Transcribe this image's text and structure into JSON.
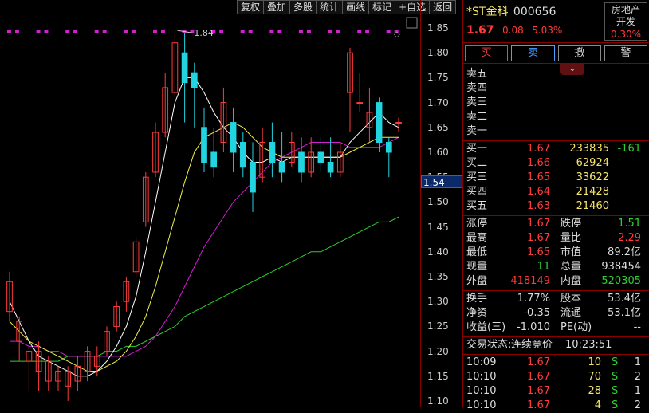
{
  "toolbar": [
    "复权",
    "叠加",
    "多股",
    "统计",
    "画线",
    "标记",
    "+自选",
    "返回"
  ],
  "chart": {
    "y_ticks": [
      "1.85",
      "1.80",
      "1.75",
      "1.70",
      "1.65",
      "1.60",
      "1.55",
      "1.50",
      "1.45",
      "1.40",
      "1.35",
      "1.30",
      "1.25",
      "1.20",
      "1.15",
      "1.10"
    ],
    "cursor_price": "1.54",
    "high_marker": "1.84"
  },
  "chart_data": {
    "type": "candlestick",
    "ylim": [
      1.1,
      1.85
    ],
    "candles": [
      [
        1.28,
        1.34,
        1.26,
        1.36
      ],
      [
        1.22,
        1.26,
        1.18,
        1.27
      ],
      [
        1.18,
        1.2,
        1.12,
        1.21
      ],
      [
        1.16,
        1.2,
        1.12,
        1.22
      ],
      [
        1.14,
        1.18,
        1.12,
        1.19
      ],
      [
        1.14,
        1.16,
        1.12,
        1.17
      ],
      [
        1.13,
        1.16,
        1.1,
        1.17
      ],
      [
        1.14,
        1.17,
        1.12,
        1.19
      ],
      [
        1.16,
        1.2,
        1.14,
        1.21
      ],
      [
        1.17,
        1.19,
        1.15,
        1.21
      ],
      [
        1.2,
        1.24,
        1.19,
        1.25
      ],
      [
        1.25,
        1.29,
        1.24,
        1.3
      ],
      [
        1.3,
        1.34,
        1.28,
        1.35
      ],
      [
        1.36,
        1.42,
        1.35,
        1.43
      ],
      [
        1.46,
        1.55,
        1.45,
        1.56
      ],
      [
        1.56,
        1.64,
        1.55,
        1.66
      ],
      [
        1.64,
        1.73,
        1.63,
        1.76
      ],
      [
        1.72,
        1.82,
        1.71,
        1.84
      ],
      [
        1.8,
        1.74,
        1.66,
        1.84
      ],
      [
        1.76,
        1.73,
        1.65,
        1.78
      ],
      [
        1.65,
        1.58,
        1.56,
        1.69
      ],
      [
        1.6,
        1.57,
        1.55,
        1.65
      ],
      [
        1.62,
        1.7,
        1.6,
        1.73
      ],
      [
        1.66,
        1.6,
        1.56,
        1.69
      ],
      [
        1.62,
        1.57,
        1.55,
        1.64
      ],
      [
        1.58,
        1.52,
        1.48,
        1.62
      ],
      [
        1.55,
        1.62,
        1.54,
        1.65
      ],
      [
        1.62,
        1.58,
        1.55,
        1.66
      ],
      [
        1.58,
        1.56,
        1.54,
        1.64
      ],
      [
        1.58,
        1.62,
        1.57,
        1.64
      ],
      [
        1.6,
        1.56,
        1.54,
        1.63
      ],
      [
        1.56,
        1.6,
        1.55,
        1.63
      ],
      [
        1.6,
        1.58,
        1.56,
        1.63
      ],
      [
        1.58,
        1.56,
        1.55,
        1.63
      ],
      [
        1.56,
        1.6,
        1.55,
        1.62
      ],
      [
        1.72,
        1.8,
        1.64,
        1.81
      ],
      [
        1.7,
        1.7,
        1.68,
        1.76
      ],
      [
        1.65,
        1.68,
        1.62,
        1.73
      ],
      [
        1.7,
        1.62,
        1.6,
        1.71
      ],
      [
        1.62,
        1.6,
        1.55,
        1.63
      ],
      [
        1.66,
        1.66,
        1.64,
        1.67
      ]
    ],
    "ma5": [
      1.3,
      1.26,
      1.22,
      1.19,
      1.18,
      1.17,
      1.16,
      1.15,
      1.15,
      1.16,
      1.18,
      1.21,
      1.25,
      1.31,
      1.4,
      1.5,
      1.6,
      1.7,
      1.75,
      1.75,
      1.72,
      1.68,
      1.65,
      1.63,
      1.6,
      1.58,
      1.58,
      1.59,
      1.58,
      1.59,
      1.59,
      1.59,
      1.59,
      1.59,
      1.59,
      1.62,
      1.64,
      1.66,
      1.68,
      1.66,
      1.65
    ],
    "ma10": [
      1.26,
      1.24,
      1.22,
      1.21,
      1.2,
      1.19,
      1.18,
      1.17,
      1.16,
      1.16,
      1.17,
      1.18,
      1.2,
      1.23,
      1.27,
      1.33,
      1.4,
      1.47,
      1.54,
      1.6,
      1.63,
      1.64,
      1.65,
      1.66,
      1.65,
      1.63,
      1.61,
      1.6,
      1.59,
      1.59,
      1.59,
      1.59,
      1.59,
      1.59,
      1.59,
      1.6,
      1.61,
      1.62,
      1.63,
      1.63,
      1.63
    ],
    "ma20": [
      1.22,
      1.22,
      1.21,
      1.21,
      1.2,
      1.2,
      1.19,
      1.19,
      1.19,
      1.19,
      1.19,
      1.19,
      1.19,
      1.2,
      1.21,
      1.23,
      1.26,
      1.29,
      1.33,
      1.37,
      1.41,
      1.44,
      1.47,
      1.5,
      1.52,
      1.54,
      1.56,
      1.58,
      1.59,
      1.6,
      1.61,
      1.62,
      1.62,
      1.62,
      1.62,
      1.61,
      1.61,
      1.61,
      1.61,
      1.62,
      1.63
    ],
    "ma60": [
      1.18,
      1.18,
      1.18,
      1.18,
      1.18,
      1.18,
      1.19,
      1.19,
      1.19,
      1.19,
      1.2,
      1.2,
      1.21,
      1.21,
      1.22,
      1.23,
      1.24,
      1.25,
      1.27,
      1.28,
      1.29,
      1.3,
      1.31,
      1.32,
      1.33,
      1.34,
      1.35,
      1.36,
      1.37,
      1.38,
      1.39,
      1.4,
      1.4,
      1.41,
      1.42,
      1.43,
      1.44,
      1.45,
      1.46,
      1.46,
      1.47
    ]
  },
  "stock": {
    "name": "*ST金科",
    "code": "000656",
    "price": "1.67",
    "change": "0.08",
    "pct": "5.03%",
    "sector": "房地产开发",
    "sector_pct": "0.30%"
  },
  "buttons": {
    "buy": "买",
    "sell": "卖",
    "cancel": "撤",
    "alert": "警"
  },
  "asks": [
    {
      "label": "卖五"
    },
    {
      "label": "卖四"
    },
    {
      "label": "卖三"
    },
    {
      "label": "卖二"
    },
    {
      "label": "卖一"
    }
  ],
  "bids": [
    {
      "label": "买一",
      "price": "1.67",
      "vol": "233835",
      "delta": "-161"
    },
    {
      "label": "买二",
      "price": "1.66",
      "vol": "62924",
      "delta": ""
    },
    {
      "label": "买三",
      "price": "1.65",
      "vol": "33622",
      "delta": ""
    },
    {
      "label": "买四",
      "price": "1.64",
      "vol": "21428",
      "delta": ""
    },
    {
      "label": "买五",
      "price": "1.63",
      "vol": "21460",
      "delta": ""
    }
  ],
  "stats": [
    {
      "l1": "涨停",
      "v1": "1.67",
      "l2": "跌停",
      "v2": "1.51"
    },
    {
      "l1": "最高",
      "v1": "1.67",
      "l2": "量比",
      "v2": "2.29"
    },
    {
      "l1": "最低",
      "v1": "1.65",
      "l2": "市值",
      "v2": "89.2亿"
    },
    {
      "l1": "现量",
      "v1": "11",
      "l2": "总量",
      "v2": "938454"
    },
    {
      "l1": "外盘",
      "v1": "418149",
      "l2": "内盘",
      "v2": "520305"
    }
  ],
  "stats2": [
    {
      "l1": "换手",
      "v1": "1.77%",
      "l2": "股本",
      "v2": "53.4亿"
    },
    {
      "l1": "净资",
      "v1": "-0.35",
      "l2": "流通",
      "v2": "53.1亿"
    },
    {
      "l1": "收益(三)",
      "v1": "-1.010",
      "l2": "PE(动)",
      "v2": "--"
    }
  ],
  "status": {
    "label": "交易状态:",
    "value": "连续竞价",
    "time": "10:23:51"
  },
  "ticks": [
    {
      "time": "10:09",
      "price": "1.67",
      "vol": "10",
      "side": "S",
      "n": "1"
    },
    {
      "time": "10:10",
      "price": "1.67",
      "vol": "70",
      "side": "S",
      "n": "2"
    },
    {
      "time": "10:10",
      "price": "1.67",
      "vol": "28",
      "side": "S",
      "n": "1"
    },
    {
      "time": "10:10",
      "price": "1.67",
      "vol": "4",
      "side": "S",
      "n": "2"
    }
  ]
}
